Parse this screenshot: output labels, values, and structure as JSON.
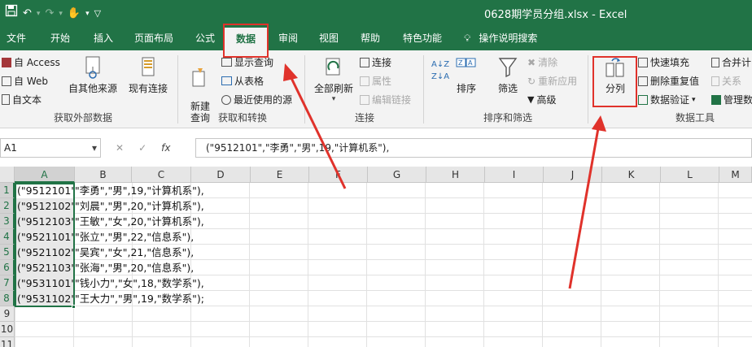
{
  "title_bar": {
    "title": "0628期学员分组.xlsx  -  Excel",
    "qat_icons": [
      "save-icon",
      "undo-icon",
      "redo-icon",
      "touch-mode-icon",
      "customize-qat-icon"
    ]
  },
  "tabs": [
    {
      "label": "文件"
    },
    {
      "label": "开始"
    },
    {
      "label": "插入"
    },
    {
      "label": "页面布局"
    },
    {
      "label": "公式"
    },
    {
      "label": "数据"
    },
    {
      "label": "审阅"
    },
    {
      "label": "视图"
    },
    {
      "label": "帮助"
    },
    {
      "label": "特色功能"
    },
    {
      "label": "操作说明搜索"
    }
  ],
  "ribbon": {
    "get_external": {
      "access": "自 Access",
      "web": "自 Web",
      "text": "自文本",
      "other_sources": "自其他来源",
      "existing": "现有连接",
      "group": "获取外部数据"
    },
    "get_transform": {
      "new_query": "新建\n查询",
      "show_queries": "显示查询",
      "from_table": "从表格",
      "recent_sources": "最近使用的源",
      "group": "获取和转换"
    },
    "connections": {
      "refresh_all": "全部刷新",
      "connections": "连接",
      "properties": "属性",
      "edit_links": "编辑链接",
      "group": "连接"
    },
    "sort_filter": {
      "sort": "排序",
      "filter": "筛选",
      "clear": "清除",
      "reapply": "重新应用",
      "advanced": "高级",
      "group": "排序和筛选"
    },
    "data_tools": {
      "text_to_columns": "分列",
      "flash_fill": "快速填充",
      "remove_duplicates": "删除重复值",
      "data_validation": "数据验证",
      "consolidate": "合并计",
      "relationships": "关系",
      "manage": "管理数",
      "group": "数据工具"
    }
  },
  "formula_bar": {
    "name_box": "A1",
    "formula": "(\"9512101\",\"李勇\",\"男\",19,\"计算机系\"),"
  },
  "grid": {
    "columns": [
      "A",
      "B",
      "C",
      "D",
      "E",
      "F",
      "G",
      "H",
      "I",
      "J",
      "K",
      "L",
      "M"
    ],
    "rows": [
      "1",
      "2",
      "3",
      "4",
      "5",
      "6",
      "7",
      "8",
      "9",
      "10",
      "11"
    ],
    "cells": [
      {
        "a": "(\"9512101'",
        "b": "\"李勇\",\"男\",19,\"计算机系\"),"
      },
      {
        "a": "(\"9512102'",
        "b": "\"刘晨\",\"男\",20,\"计算机系\"),"
      },
      {
        "a": "(\"9512103'",
        "b": "\"王敏\",\"女\",20,\"计算机系\"),"
      },
      {
        "a": "(\"9521101'",
        "b": "\"张立\",\"男\",22,\"信息系\"),"
      },
      {
        "a": "(\"9521102'",
        "b": "\"吴宾\",\"女\",21,\"信息系\"),"
      },
      {
        "a": "(\"9521103'",
        "b": "\"张海\",\"男\",20,\"信息系\"),"
      },
      {
        "a": "(\"9531101'",
        "b": "\"钱小力\",\"女\",18,\"数学系\"),"
      },
      {
        "a": "(\"9531102'",
        "b": "\"王大力\",\"男\",19,\"数学系\");"
      }
    ]
  },
  "colors": {
    "accent": "#217346",
    "highlight": "#e0322b"
  }
}
